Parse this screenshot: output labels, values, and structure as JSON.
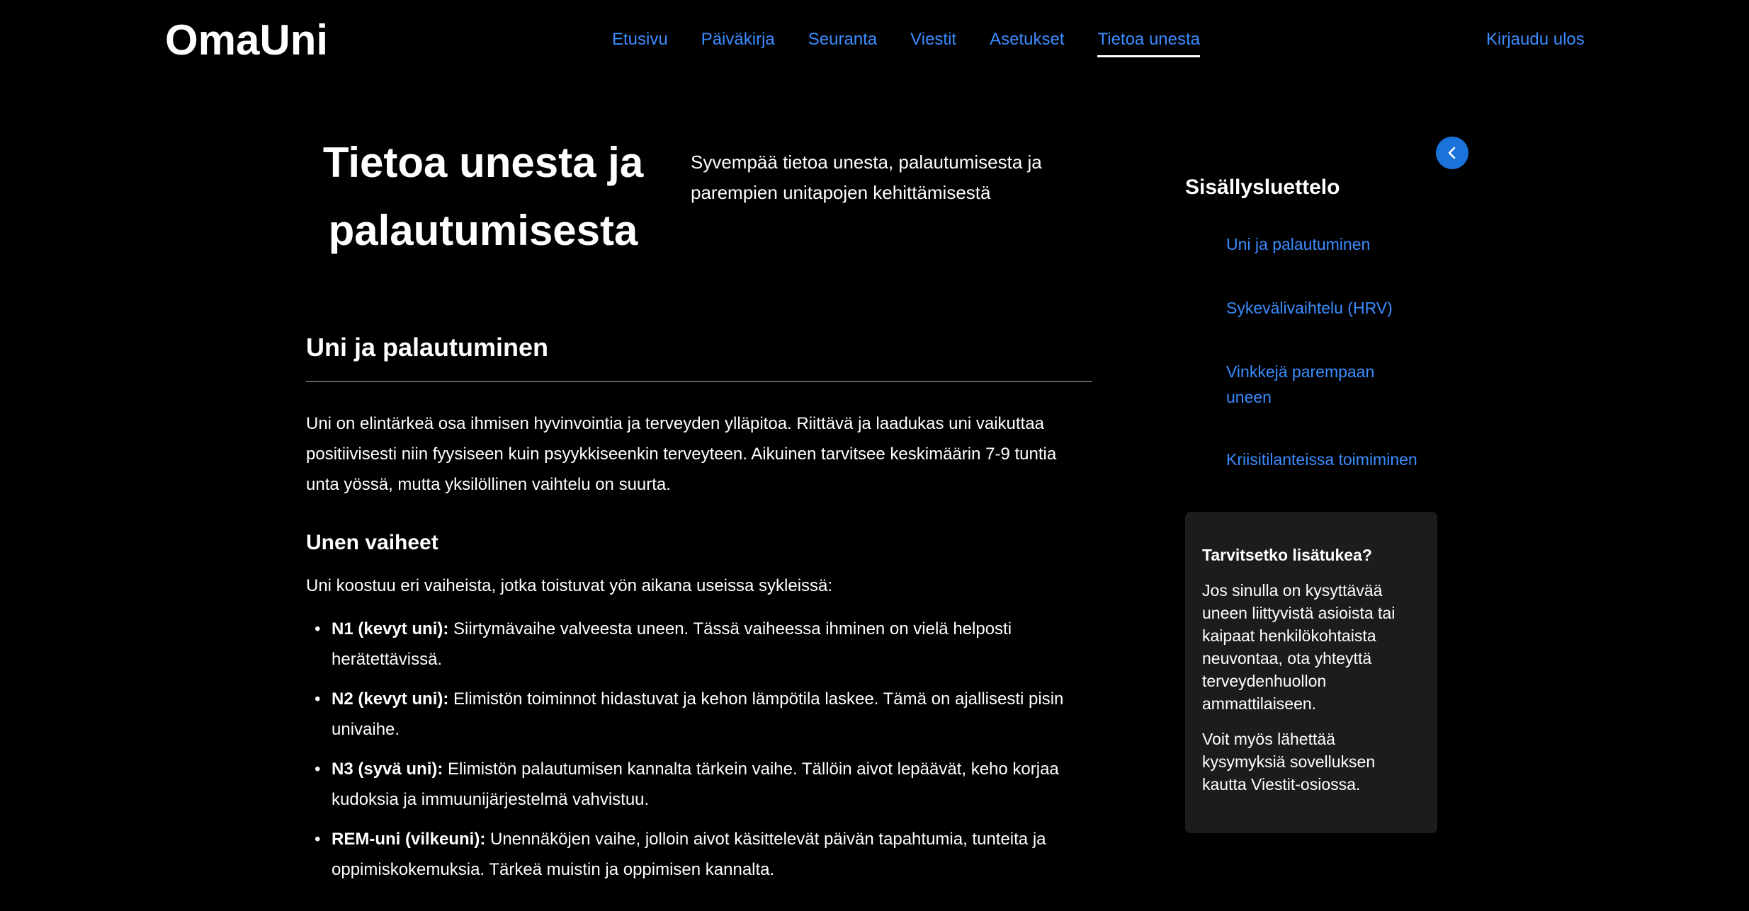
{
  "header": {
    "logo": "OmaUni",
    "nav": [
      "Etusivu",
      "Päiväkirja",
      "Seuranta",
      "Viestit",
      "Asetukset",
      "Tietoa unesta"
    ],
    "active": "Tietoa unesta",
    "logout": "Kirjaudu ulos"
  },
  "hero": {
    "title": "Tietoa unesta ja palautumisesta",
    "subtitle": "Syvempää tietoa unesta, palautumisesta ja parempien unitapojen kehittämisestä"
  },
  "main": {
    "section_title": "Uni ja palautuminen",
    "intro": "Uni on elintärkeä osa ihmisen hyvinvointia ja terveyden ylläpitoa. Riittävä ja laadukas uni vaikuttaa positiivisesti niin fyysiseen kuin psyykkiseenkin terveyteen. Aikuinen tarvitsee keskimäärin 7-9 tuntia unta yössä, mutta yksilöllinen vaihtelu on suurta.",
    "phases_title": "Unen vaiheet",
    "phases_intro": "Uni koostuu eri vaiheista, jotka toistuvat yön aikana useissa sykleissä:",
    "phases": [
      {
        "term": "N1 (kevyt uni):",
        "text": " Siirtymävaihe valveesta uneen. Tässä vaiheessa ihminen on vielä helposti herätettävissä."
      },
      {
        "term": "N2 (kevyt uni):",
        "text": " Elimistön toiminnot hidastuvat ja kehon lämpötila laskee. Tämä on ajallisesti pisin univaihe."
      },
      {
        "term": "N3 (syvä uni):",
        "text": " Elimistön palautumisen kannalta tärkein vaihe. Tällöin aivot lepäävät, keho korjaa kudoksia ja immuunijärjestelmä vahvistuu."
      },
      {
        "term": "REM-uni (vilkeuni):",
        "text": " Unennäköjen vaihe, jolloin aivot käsittelevät päivän tapahtumia, tunteita ja oppimiskokemuksia. Tärkeä muistin ja oppimisen kannalta."
      }
    ]
  },
  "sidebar": {
    "toc_title": "Sisällysluettelo",
    "toc_items": [
      "Uni ja palautuminen",
      "Sykevälivaihtelu (HRV)",
      "Vinkkejä parempaan uneen",
      "Kriisitilanteissa toimiminen"
    ],
    "help_title": "Tarvitsetko lisätukea?",
    "help_text1": "Jos sinulla on kysyttävää uneen liittyvistä asioista tai kaipaat henkilökohtaista neuvontaa, ota yhteyttä terveydenhuollon ammattilaiseen.",
    "help_text2": "Voit myös lähettää kysymyksiä sovelluksen kautta Viestit-osiossa."
  },
  "colors": {
    "background": "#000000",
    "link": "#3b8cff",
    "back_button": "#1a73d9",
    "panel": "#1c1c1c"
  },
  "icons": {
    "back": "chevron-left-icon"
  }
}
